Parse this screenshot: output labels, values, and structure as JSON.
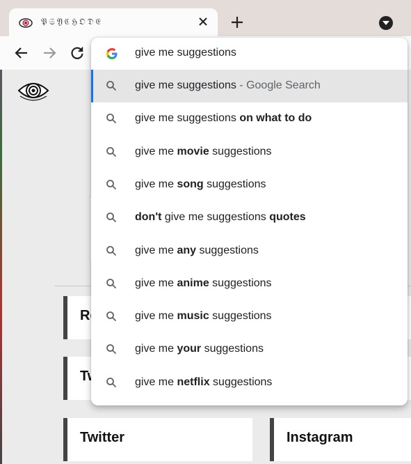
{
  "tab": {
    "title": "𝔓𝔖𝔜ℭℌ𝔒𝔇𝔈",
    "close_icon": "close-icon",
    "favicon": "eye-spiral-icon"
  },
  "toolbar": {
    "back_icon": "back-arrow-icon",
    "forward_icon": "forward-arrow-icon",
    "reload_icon": "reload-icon"
  },
  "omnibox": {
    "query": "give me suggestions",
    "provider_icon": "google-g-icon",
    "suggestions": [
      {
        "parts": [
          {
            "t": "give me suggestions",
            "b": false
          },
          {
            "t": " - Google Search",
            "b": false,
            "d": true
          }
        ],
        "selected": true
      },
      {
        "parts": [
          {
            "t": "give me suggestions ",
            "b": false
          },
          {
            "t": "on what to do",
            "b": true
          }
        ]
      },
      {
        "parts": [
          {
            "t": "give me ",
            "b": false
          },
          {
            "t": "movie",
            "b": true
          },
          {
            "t": " suggestions",
            "b": false
          }
        ]
      },
      {
        "parts": [
          {
            "t": "give me ",
            "b": false
          },
          {
            "t": "song",
            "b": true
          },
          {
            "t": " suggestions",
            "b": false
          }
        ]
      },
      {
        "parts": [
          {
            "t": "don't",
            "b": true
          },
          {
            "t": " give me suggestions ",
            "b": false
          },
          {
            "t": "quotes",
            "b": true
          }
        ]
      },
      {
        "parts": [
          {
            "t": "give me ",
            "b": false
          },
          {
            "t": "any",
            "b": true
          },
          {
            "t": " suggestions",
            "b": false
          }
        ]
      },
      {
        "parts": [
          {
            "t": "give me ",
            "b": false
          },
          {
            "t": "anime",
            "b": true
          },
          {
            "t": " suggestions",
            "b": false
          }
        ]
      },
      {
        "parts": [
          {
            "t": "give me ",
            "b": false
          },
          {
            "t": "music",
            "b": true
          },
          {
            "t": " suggestions",
            "b": false
          }
        ]
      },
      {
        "parts": [
          {
            "t": "give me ",
            "b": false
          },
          {
            "t": "your",
            "b": true
          },
          {
            "t": " suggestions",
            "b": false
          }
        ]
      },
      {
        "parts": [
          {
            "t": "give me ",
            "b": false
          },
          {
            "t": "netflix",
            "b": true
          },
          {
            "t": " suggestions",
            "b": false
          }
        ]
      }
    ]
  },
  "page": {
    "logo_icon": "eye-spiral-logo-icon",
    "cards": [
      {
        "label": "Re"
      },
      {
        "label": "Tw"
      },
      {
        "label": "Twitter"
      },
      {
        "label": "Instagram"
      }
    ]
  },
  "colors": {
    "accent": "#1a73e8",
    "selected_bg": "#e5e5e5",
    "card_border": "#444444"
  }
}
